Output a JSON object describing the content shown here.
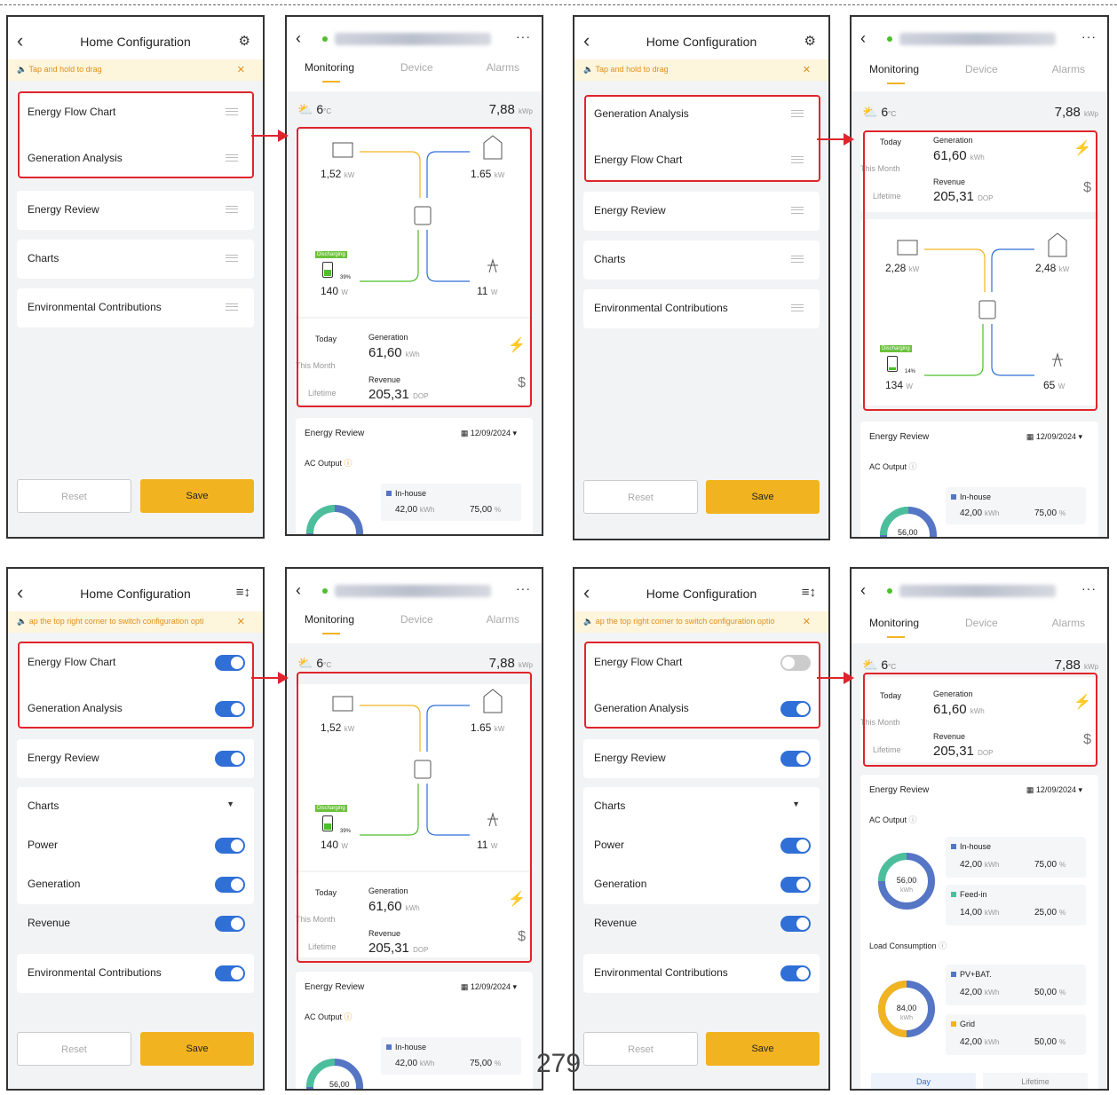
{
  "config": {
    "title": "Home Configuration",
    "tip_drag": "Tap and hold to drag",
    "tip_switch": "ap the top right corner to switch configuration opti",
    "tip_switch2": "ap the top right corner to switch configuration optio",
    "reset": "Reset",
    "save": "Save",
    "items_a": [
      "Energy Flow Chart",
      "Generation Analysis",
      "Energy Review",
      "Charts",
      "Environmental Contributions"
    ],
    "items_b": [
      "Generation Analysis",
      "Energy Flow Chart",
      "Energy Review",
      "Charts",
      "Environmental Contributions"
    ],
    "items_c": [
      "Energy Flow Chart",
      "Generation Analysis",
      "Energy Review",
      "Charts",
      "Power",
      "Generation",
      "Revenue",
      "Environmental Contributions"
    ]
  },
  "mon": {
    "tabs": [
      "Monitoring",
      "Device",
      "Alarms"
    ],
    "temp": "6",
    "temp_unit": "°C",
    "kwp": "7,88",
    "kwp_unit": "kWp",
    "flow1": {
      "pv": "1,52",
      "pv_u": "kW",
      "home": "1.65",
      "home_u": "kW",
      "bat": "140",
      "bat_u": "W",
      "soc": "39%",
      "grid": "11",
      "grid_u": "W",
      "badge": "Discharging"
    },
    "flow2": {
      "pv": "2,28",
      "pv_u": "kW",
      "home": "2,48",
      "home_u": "kW",
      "bat": "134",
      "bat_u": "W",
      "soc": "14%",
      "grid": "65",
      "grid_u": "W",
      "badge": "Discharging"
    },
    "periods": [
      "Today",
      "This Month",
      "Lifetime"
    ],
    "gen_label": "Generation",
    "gen": "61,60",
    "gen_u": "kWh",
    "rev_label": "Revenue",
    "rev": "205,31",
    "rev_u": "DOP",
    "review": {
      "title": "Energy Review",
      "date": "12/09/2024",
      "ac": "AC Output",
      "donut": "56,00",
      "donut_u": "kWh",
      "inhouse": "In-house",
      "inhouse_v": "42,00",
      "inhouse_p": "75,00",
      "feed": "Feed-in",
      "feed_v": "14,00",
      "feed_p": "25,00",
      "load": "Load Consumption",
      "donut2": "84,00",
      "pvbat": "PV+BAT.",
      "pvbat_v": "42,00",
      "pvbat_p": "50,00",
      "grid": "Grid",
      "grid_v": "42,00",
      "grid_p": "50,00",
      "kwh": "kWh",
      "pct": "%",
      "day": "Day",
      "life": "Lifetime"
    }
  },
  "page_number": "279",
  "colors": {
    "accent": "#f2b321",
    "toggle": "#2f6fd6",
    "highlight": "#e0242c",
    "pv_line": "#f2b321",
    "grid_line": "#2f6fd6",
    "bat_line": "#4cbf2a"
  }
}
